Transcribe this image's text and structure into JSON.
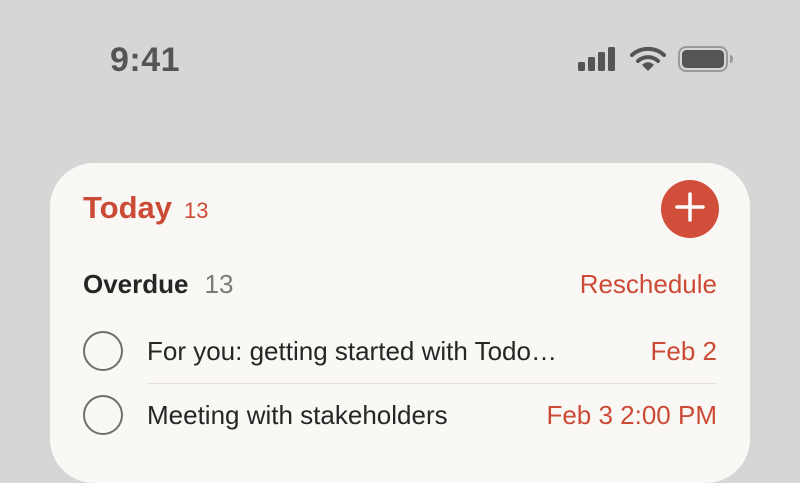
{
  "status_bar": {
    "time": "9:41",
    "icons": [
      "cellular-signal-icon",
      "wifi-icon",
      "battery-icon"
    ]
  },
  "widget": {
    "title": "Today",
    "title_count": "13",
    "add_icon": "plus-icon",
    "section": {
      "title": "Overdue",
      "count": "13",
      "action_label": "Reschedule"
    },
    "tasks": [
      {
        "title": "For you: getting started with Todo…",
        "date": "Feb 2"
      },
      {
        "title": "Meeting with stakeholders",
        "date": "Feb 3 2:00 PM"
      }
    ]
  },
  "colors": {
    "background": "#d6d6d6",
    "card": "#faf8f5",
    "accent": "#cc4b36",
    "text": "#262626",
    "muted": "#7a7a7a"
  }
}
